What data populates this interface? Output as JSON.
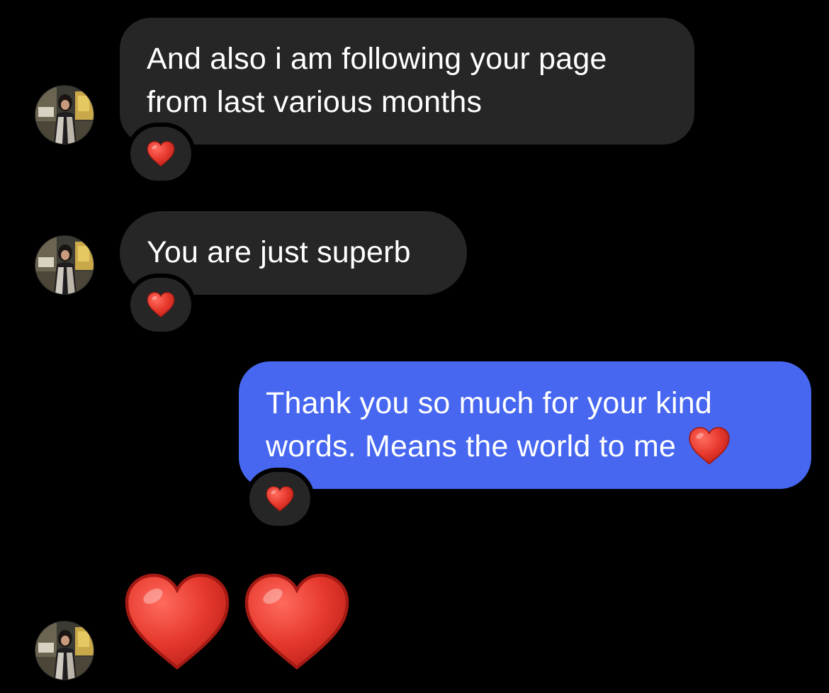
{
  "messages": [
    {
      "direction": "incoming",
      "lines": [
        "And also i am following your page",
        "from last various months"
      ],
      "reaction": "red-heart"
    },
    {
      "direction": "incoming",
      "lines": [
        "You are just superb"
      ],
      "reaction": "red-heart"
    },
    {
      "direction": "outgoing",
      "lines": [
        "Thank you so much for your kind",
        "words. Means the world to me"
      ],
      "inline_emoji": "red-heart",
      "reaction": "red-heart"
    },
    {
      "direction": "incoming",
      "emoji_only": [
        "red-heart",
        "red-heart"
      ]
    }
  ],
  "colors": {
    "background": "#000000",
    "incoming_bubble": "#262626",
    "outgoing_bubble": "#4767f0",
    "text": "#ffffff",
    "heart": "#e8352b"
  }
}
